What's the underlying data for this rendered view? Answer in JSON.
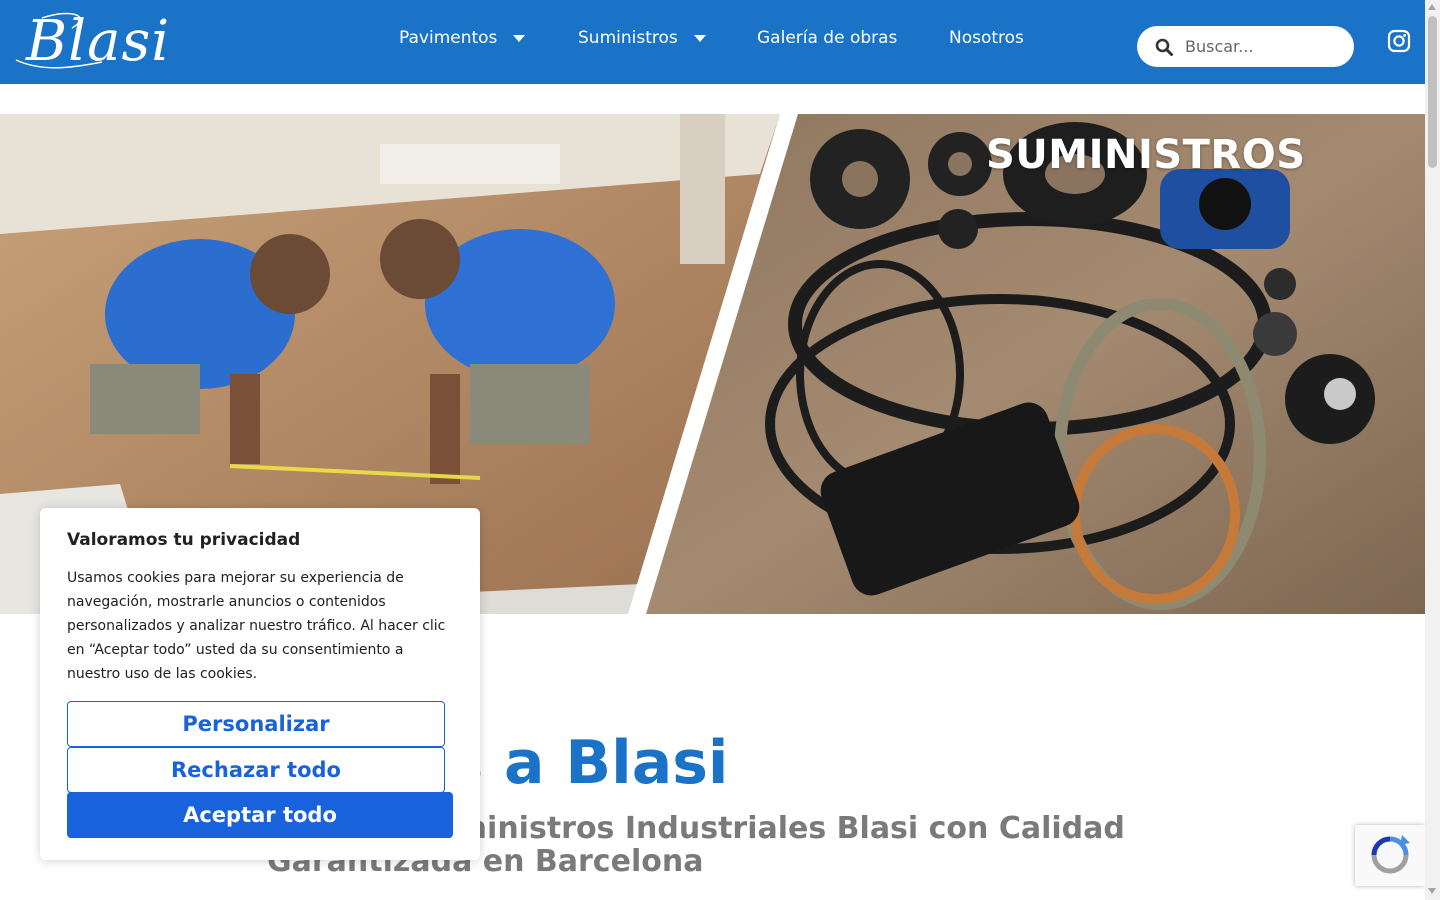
{
  "header": {
    "logo_text": "Blasi",
    "nav": [
      {
        "label": "Pavimentos",
        "has_dropdown": true
      },
      {
        "label": "Suministros",
        "has_dropdown": true
      },
      {
        "label": "Galería de obras",
        "has_dropdown": false
      },
      {
        "label": "Nosotros",
        "has_dropdown": false
      }
    ],
    "search_placeholder": "Buscar...",
    "social_icon": "instagram-icon"
  },
  "hero": {
    "title": "SUMINISTROS"
  },
  "welcome": {
    "title": "nidos a Blasi",
    "subtitle": "igeros y Suministros Industriales Blasi con Calidad Garantizada en Barcelona"
  },
  "cookie_banner": {
    "title": "Valoramos tu privacidad",
    "body": "Usamos cookies para mejorar su experiencia de navegación, mostrarle anuncios o contenidos personalizados y analizar nuestro tráfico. Al hacer clic en “Aceptar todo” usted da su consentimiento a nuestro uso de las cookies.",
    "customize_label": "Personalizar",
    "reject_label": "Rechazar todo",
    "accept_label": "Aceptar todo"
  },
  "colors": {
    "header_bg": "#1b73c7",
    "primary": "#1863dc",
    "heading_blue": "#1b73c7",
    "subtitle_gray": "#7a7a7a"
  }
}
